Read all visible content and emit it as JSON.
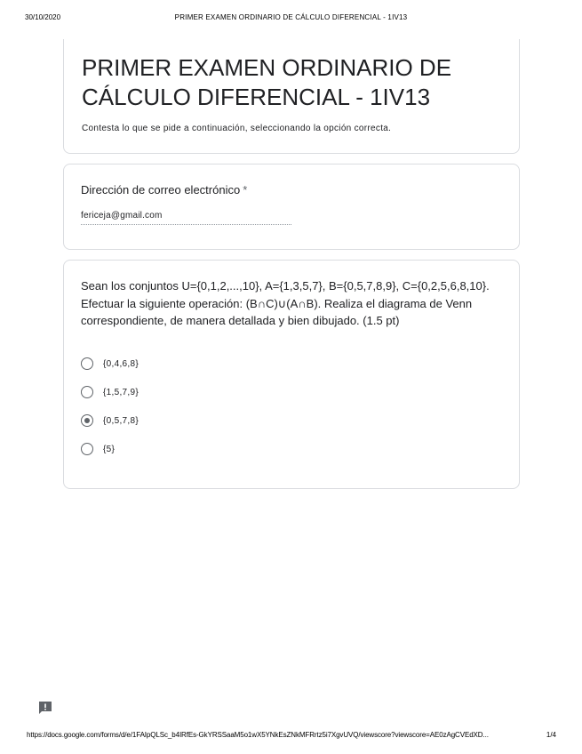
{
  "print_header": {
    "date": "30/10/2020",
    "title": "PRIMER EXAMEN ORDINARIO DE CÁLCULO DIFERENCIAL - 1IV13"
  },
  "form": {
    "title": "PRIMER EXAMEN ORDINARIO DE CÁLCULO DIFERENCIAL - 1IV13",
    "description": "Contesta lo que se pide a continuación, seleccionando la opción correcta."
  },
  "email": {
    "label": "Dirección de correo electrónico",
    "required_mark": "*",
    "value": "fericeja@gmail.com"
  },
  "question": {
    "text": "Sean los conjuntos U={0,1,2,...,10}, A={1,3,5,7}, B={0,5,7,8,9}, C={0,2,5,6,8,10}. Efectuar la siguiente operación: (B∩C)∪(A∩B). Realiza el diagrama de Venn correspondiente, de manera detallada y bien dibujado. (1.5 pt)",
    "options": [
      {
        "label": "{0,4,6,8}",
        "selected": false
      },
      {
        "label": "{1,5,7,9}",
        "selected": false
      },
      {
        "label": "{0,5,7,8}",
        "selected": true
      },
      {
        "label": "{5}",
        "selected": false
      }
    ]
  },
  "feedback_icon": "report-feedback-icon",
  "print_footer": {
    "url": "https://docs.google.com/forms/d/e/1FAIpQLSc_b4IRfEs-GkYRSSaaM5o1wX5YNkEsZNkMFRrtz5i7XgvUVQ/viewscore?viewscore=AE0zAgCVEdXD...",
    "page": "1/4"
  },
  "colors": {
    "text": "#202124",
    "border": "#dadce0",
    "radio": "#5f6368"
  }
}
